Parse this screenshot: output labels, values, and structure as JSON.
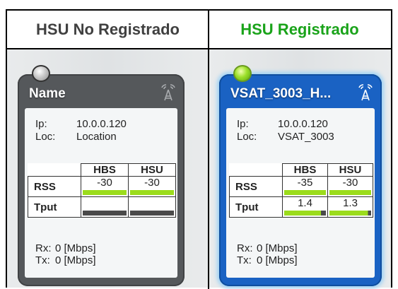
{
  "headers": {
    "left": "HSU No Registrado",
    "right": "HSU Registrado"
  },
  "cards": [
    {
      "status": "unregistered",
      "title": "Name",
      "ip_label": "Ip:",
      "ip": "10.0.0.120",
      "loc_label": "Loc:",
      "loc": "Location",
      "col_hbs": "HBS",
      "col_hsu": "HSU",
      "rss_label": "RSS",
      "rss_hbs": "-30",
      "rss_hsu": "-30",
      "tput_label": "Tput",
      "tput_hbs": "",
      "tput_hsu": "",
      "rx_label": "Rx:",
      "rx": "0 [Mbps]",
      "tx_label": "Tx:",
      "tx": "0 [Mbps]"
    },
    {
      "status": "registered",
      "title": "VSAT_3003_H...",
      "ip_label": "Ip:",
      "ip": "10.0.0.120",
      "loc_label": "Loc:",
      "loc": "VSAT_3003",
      "col_hbs": "HBS",
      "col_hsu": "HSU",
      "rss_label": "RSS",
      "rss_hbs": "-35",
      "rss_hsu": "-30",
      "tput_label": "Tput",
      "tput_hbs": "1.4",
      "tput_hsu": "1.3",
      "rx_label": "Rx:",
      "rx": "0 [Mbps]",
      "tx_label": "Tx:",
      "tx": "0 [Mbps]"
    }
  ],
  "colors": {
    "registered_header": "#1aa31a",
    "unregistered_header": "#404040",
    "card_gray": "#55585b",
    "card_blue": "#1a62c3",
    "signal_bar": "#9bdc1c"
  },
  "icons": [
    "status-led-off-icon",
    "status-led-on-icon",
    "antenna-icon"
  ]
}
